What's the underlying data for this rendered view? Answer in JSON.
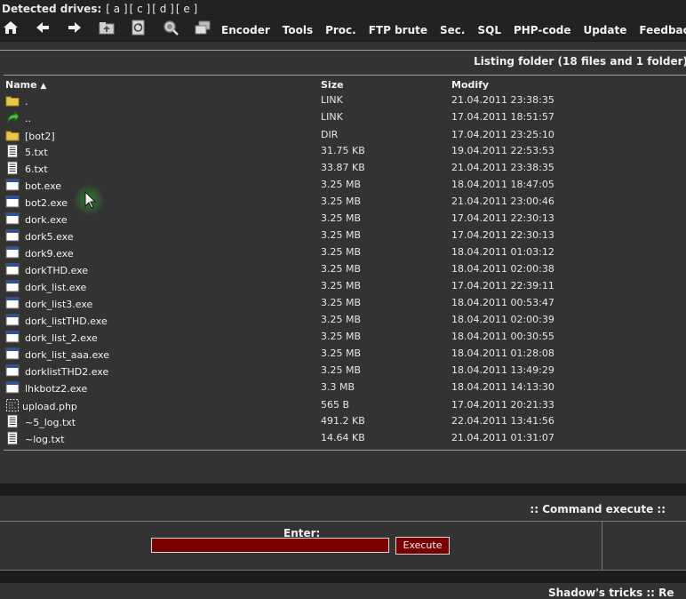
{
  "drives": {
    "label": "Detected drives:",
    "items": [
      "[ a ]",
      "[ c ]",
      "[ d ]",
      "[ e ]"
    ]
  },
  "toolbar_icons": [
    "home-icon",
    "back-icon",
    "forward-icon",
    "up-folder-icon",
    "refresh-icon",
    "search-icon",
    "folder-tree-icon"
  ],
  "menu": [
    "Encoder",
    "Tools",
    "Proc.",
    "FTP brute",
    "Sec.",
    "SQL",
    "PHP-code",
    "Update",
    "Feedback"
  ],
  "listing_title": "Listing folder (18 files and 1 folder)",
  "columns": {
    "name": "Name",
    "sort": "▲",
    "size": "Size",
    "modify": "Modify"
  },
  "files": [
    {
      "icon": "folder-icon",
      "name": ".",
      "size": "LINK",
      "modify": "21.04.2011 23:38:35"
    },
    {
      "icon": "parent-icon",
      "name": "..",
      "size": "LINK",
      "modify": "17.04.2011 18:51:57"
    },
    {
      "icon": "folder-icon",
      "name": "[bot2]",
      "size": "DIR",
      "modify": "17.04.2011 23:25:10"
    },
    {
      "icon": "text-file-icon",
      "name": "5.txt",
      "size": "31.75 KB",
      "modify": "19.04.2011 22:53:53"
    },
    {
      "icon": "text-file-icon",
      "name": "6.txt",
      "size": "33.87 KB",
      "modify": "21.04.2011 23:38:35"
    },
    {
      "icon": "exe-file-icon",
      "name": "bot.exe",
      "size": "3.25 MB",
      "modify": "18.04.2011 18:47:05"
    },
    {
      "icon": "exe-file-icon",
      "name": "bot2.exe",
      "size": "3.25 MB",
      "modify": "21.04.2011 23:00:46"
    },
    {
      "icon": "exe-file-icon",
      "name": "dork.exe",
      "size": "3.25 MB",
      "modify": "17.04.2011 22:30:13"
    },
    {
      "icon": "exe-file-icon",
      "name": "dork5.exe",
      "size": "3.25 MB",
      "modify": "17.04.2011 22:30:13"
    },
    {
      "icon": "exe-file-icon",
      "name": "dork9.exe",
      "size": "3.25 MB",
      "modify": "18.04.2011 01:03:12"
    },
    {
      "icon": "exe-file-icon",
      "name": "dorkTHD.exe",
      "size": "3.25 MB",
      "modify": "18.04.2011 02:00:38"
    },
    {
      "icon": "exe-file-icon",
      "name": "dork_list.exe",
      "size": "3.25 MB",
      "modify": "17.04.2011 22:39:11"
    },
    {
      "icon": "exe-file-icon",
      "name": "dork_list3.exe",
      "size": "3.25 MB",
      "modify": "18.04.2011 00:53:47"
    },
    {
      "icon": "exe-file-icon",
      "name": "dork_listTHD.exe",
      "size": "3.25 MB",
      "modify": "18.04.2011 02:00:39"
    },
    {
      "icon": "exe-file-icon",
      "name": "dork_list_2.exe",
      "size": "3.25 MB",
      "modify": "18.04.2011 00:30:55"
    },
    {
      "icon": "exe-file-icon",
      "name": "dork_list_aaa.exe",
      "size": "3.25 MB",
      "modify": "18.04.2011 01:28:08"
    },
    {
      "icon": "exe-file-icon",
      "name": "dorklistTHD2.exe",
      "size": "3.25 MB",
      "modify": "18.04.2011 13:49:29"
    },
    {
      "icon": "exe-file-icon",
      "name": "lhkbotz2.exe",
      "size": "3.3 MB",
      "modify": "18.04.2011 14:13:30"
    },
    {
      "icon": "php-file-icon",
      "name": "upload.php",
      "size": "565 B",
      "modify": "17.04.2011 20:21:33"
    },
    {
      "icon": "text-file-icon",
      "name": "~5_log.txt",
      "size": "491.2 KB",
      "modify": "22.04.2011 13:41:56"
    },
    {
      "icon": "text-file-icon",
      "name": "~log.txt",
      "size": "14.64 KB",
      "modify": "21.04.2011 01:31:07"
    }
  ],
  "command": {
    "title": ":: Command execute ::",
    "enter_label": "Enter:",
    "input_value": "",
    "execute_label": "Execute"
  },
  "footer_text": "Shadow's tricks :: Re",
  "colors": {
    "background": "#333333",
    "panel": "#222222",
    "input": "#7a0000"
  }
}
